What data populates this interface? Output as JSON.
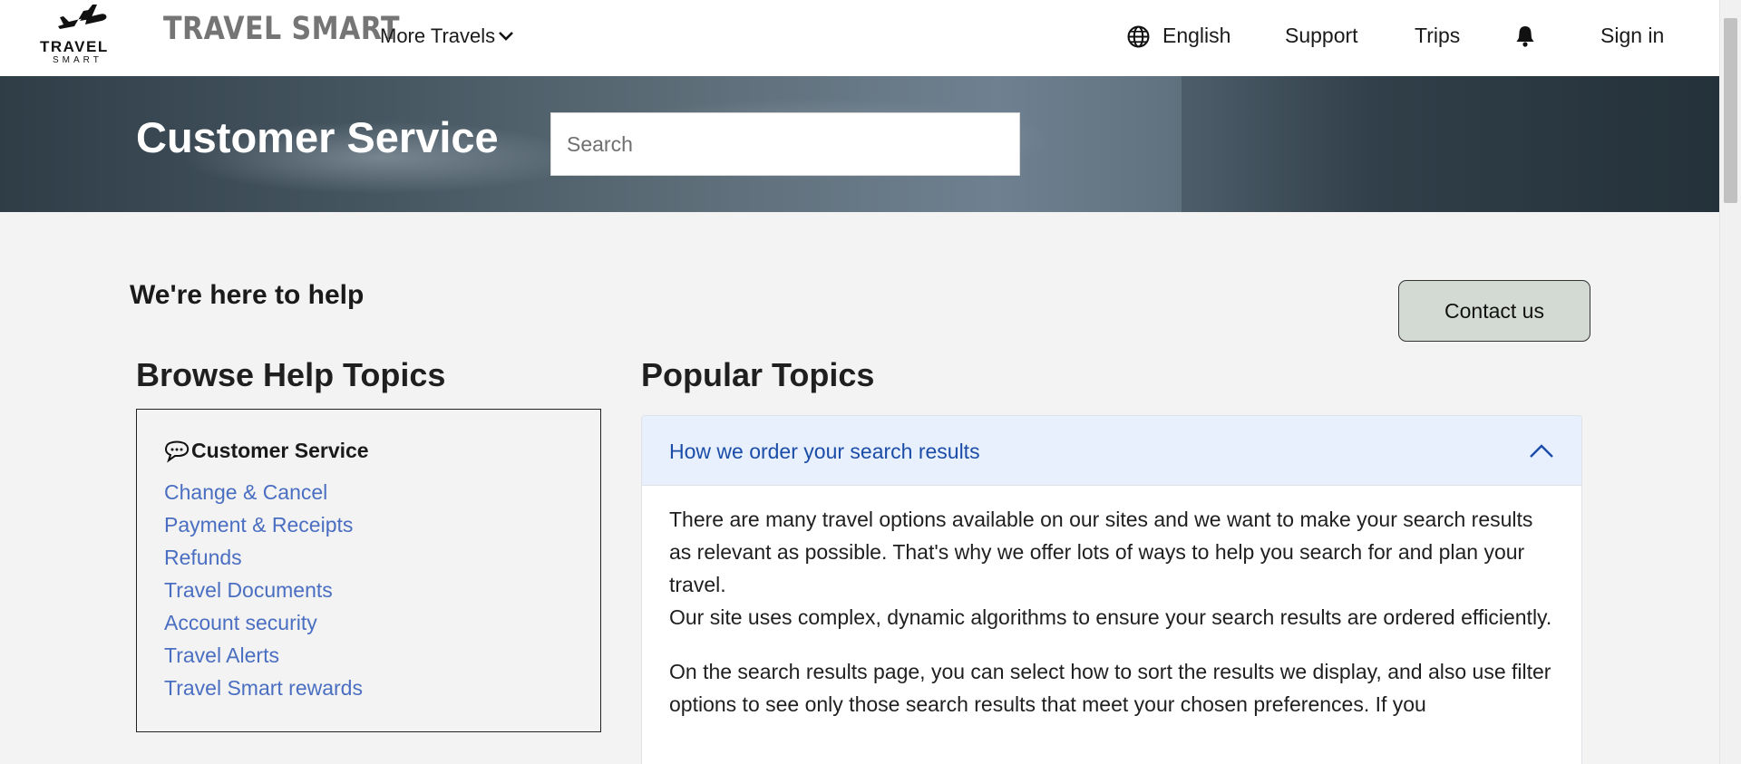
{
  "header": {
    "logo_line1": "TRAVEL",
    "logo_line2": "SMART",
    "brand": "TRAVEL SMART",
    "more_travels": "More Travels",
    "language": "English",
    "support": "Support",
    "trips": "Trips",
    "sign_in": "Sign in",
    "icons": [
      "airplane-icon",
      "chevron-down-icon",
      "globe-icon",
      "bell-icon"
    ]
  },
  "hero": {
    "title": "Customer Service",
    "search_placeholder": "Search"
  },
  "main": {
    "help_title": "We're here to help",
    "contact_button": "Contact us",
    "browse": {
      "title": "Browse Help Topics",
      "box_heading": "Customer Service",
      "items": [
        "Change & Cancel",
        "Payment & Receipts",
        "Refunds",
        "Travel Documents",
        "Account security",
        "Travel Alerts",
        "Travel Smart rewards"
      ]
    },
    "popular": {
      "title": "Popular Topics",
      "accordion_title": "How we order your search results",
      "paragraph1": "There are many travel options available on our sites and we want to make your search results as relevant as possible. That's why we offer lots of ways to help you search for and plan your travel.",
      "paragraph2": "Our site uses complex, dynamic algorithms to ensure your search results are ordered efficiently.",
      "paragraph3": "On the search results page, you can select how to sort the results we display, and also use filter options to see only those search results that meet your chosen preferences. If you"
    }
  },
  "colors": {
    "link": "#4a6ec1",
    "accordion_header_bg": "#e7f0fc",
    "accordion_title": "#1b4ca8",
    "contact_bg": "#d3dad3",
    "brand_gray": "#757575"
  }
}
